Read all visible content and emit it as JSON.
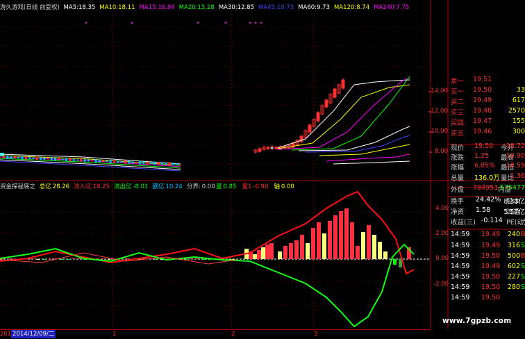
{
  "ma_header": {
    "title": "游久游戏(日线 前复权)",
    "items": [
      {
        "label": "MA5:",
        "value": "18.35",
        "color": "#ffffff"
      },
      {
        "label": "MA10:",
        "value": "18.11",
        "color": "#ffff00"
      },
      {
        "label": "MA15:",
        "value": "16.84",
        "color": "#ff00ff"
      },
      {
        "label": "MA20:",
        "value": "15.28",
        "color": "#00ff00"
      },
      {
        "label": "MA30:",
        "value": "12.85",
        "color": "#ffffff"
      },
      {
        "label": "MA45:",
        "value": "10.73",
        "color": "#4040ff"
      },
      {
        "label": "MA60:",
        "value": "9.73",
        "color": "#ffffff"
      },
      {
        "label": "MA120:",
        "value": "8.74",
        "color": "#ffff00"
      },
      {
        "label": "MA240:",
        "value": "7.75",
        "color": "#ff00ff"
      }
    ]
  },
  "indicator_header": {
    "title": "资金探秘底之",
    "items": [
      {
        "label": "总亿",
        "value": "28.26",
        "color": "#ffff00"
      },
      {
        "label": "流入亿",
        "value": "18.25",
        "color": "#ff3030"
      },
      {
        "label": "流出亿",
        "value": "-8.01",
        "color": "#00ff00"
      },
      {
        "label": "额亿",
        "value": "10.24",
        "color": "#00c0ff"
      },
      {
        "label": "分界:",
        "value": "0.00",
        "color": "#cccccc"
      }
    ],
    "right_items": [
      {
        "label": "量",
        "value": "0.85",
        "color": "#00ff00"
      },
      {
        "label": "量1",
        "value": "-0.90",
        "color": "#ff3030"
      },
      {
        "label": "轴",
        "value": "0.00",
        "color": "#ffff00"
      }
    ]
  },
  "price_axis": [
    "14.00",
    "12.00",
    "10.00",
    "8.00"
  ],
  "ind_axis": [
    "4.00",
    "2.00",
    "0.00",
    "-2.00"
  ],
  "order_book": {
    "top_partial": {
      "label": "卖一",
      "price": "19.51",
      "vol": ""
    },
    "bids": [
      {
        "label": "买一",
        "price": "19.50",
        "vol": "33"
      },
      {
        "label": "买二",
        "price": "19.49",
        "vol": "617"
      },
      {
        "label": "买三",
        "price": "19.48",
        "vol": "2570"
      },
      {
        "label": "买四",
        "price": "19.47",
        "vol": "155"
      },
      {
        "label": "买五",
        "price": "19.46",
        "vol": "300"
      }
    ]
  },
  "quote": [
    {
      "l1": "现价",
      "v1": "19.50",
      "l2": "今开",
      "v2": "18.72"
    },
    {
      "l1": "涨跌",
      "v1": "1.25",
      "l2": "最高",
      "v2": "19.90"
    },
    {
      "l1": "涨幅",
      "v1": "6.85%",
      "l2": "最低",
      "v2": "18.59"
    },
    {
      "l1": "总量",
      "v1": "136.0万",
      "l2": "量比",
      "v2": "1.36"
    }
  ],
  "outer_inner": {
    "l1": "外盘",
    "v1": "784951",
    "l2": "内盘",
    "v2": "575477"
  },
  "stats": [
    {
      "l1": "换手",
      "v1": "24.42%",
      "l2": "股本",
      "v2": "8.33亿"
    },
    {
      "l1": "净资",
      "v1": "1.58",
      "l2": "流通",
      "v2": "5.57亿"
    },
    {
      "l1": "收益(三)",
      "v1": "-0.114",
      "l2": "PE(动)",
      "v2": "-"
    }
  ],
  "ticks": [
    {
      "time": "14:59",
      "price": "19.49",
      "vol": "240",
      "flag": "B"
    },
    {
      "time": "14:59",
      "price": "19.49",
      "vol": "316",
      "flag": "S"
    },
    {
      "time": "14:59",
      "price": "19.50",
      "vol": "500",
      "flag": "B"
    },
    {
      "time": "14:59",
      "price": "19.49",
      "vol": "602",
      "flag": "S"
    },
    {
      "time": "14:59",
      "price": "19.50",
      "vol": "227",
      "flag": "S"
    },
    {
      "time": "14:59",
      "price": "19.50",
      "vol": "280",
      "flag": "S"
    },
    {
      "time": "14:59",
      "price": "19.50",
      "vol": "",
      "flag": ""
    }
  ],
  "date_bar": {
    "selected": "2014/12/09/二",
    "prefix": "201",
    "ticks": [
      "1",
      "2",
      "3"
    ]
  },
  "watermark": "www.7gpzb.com"
}
